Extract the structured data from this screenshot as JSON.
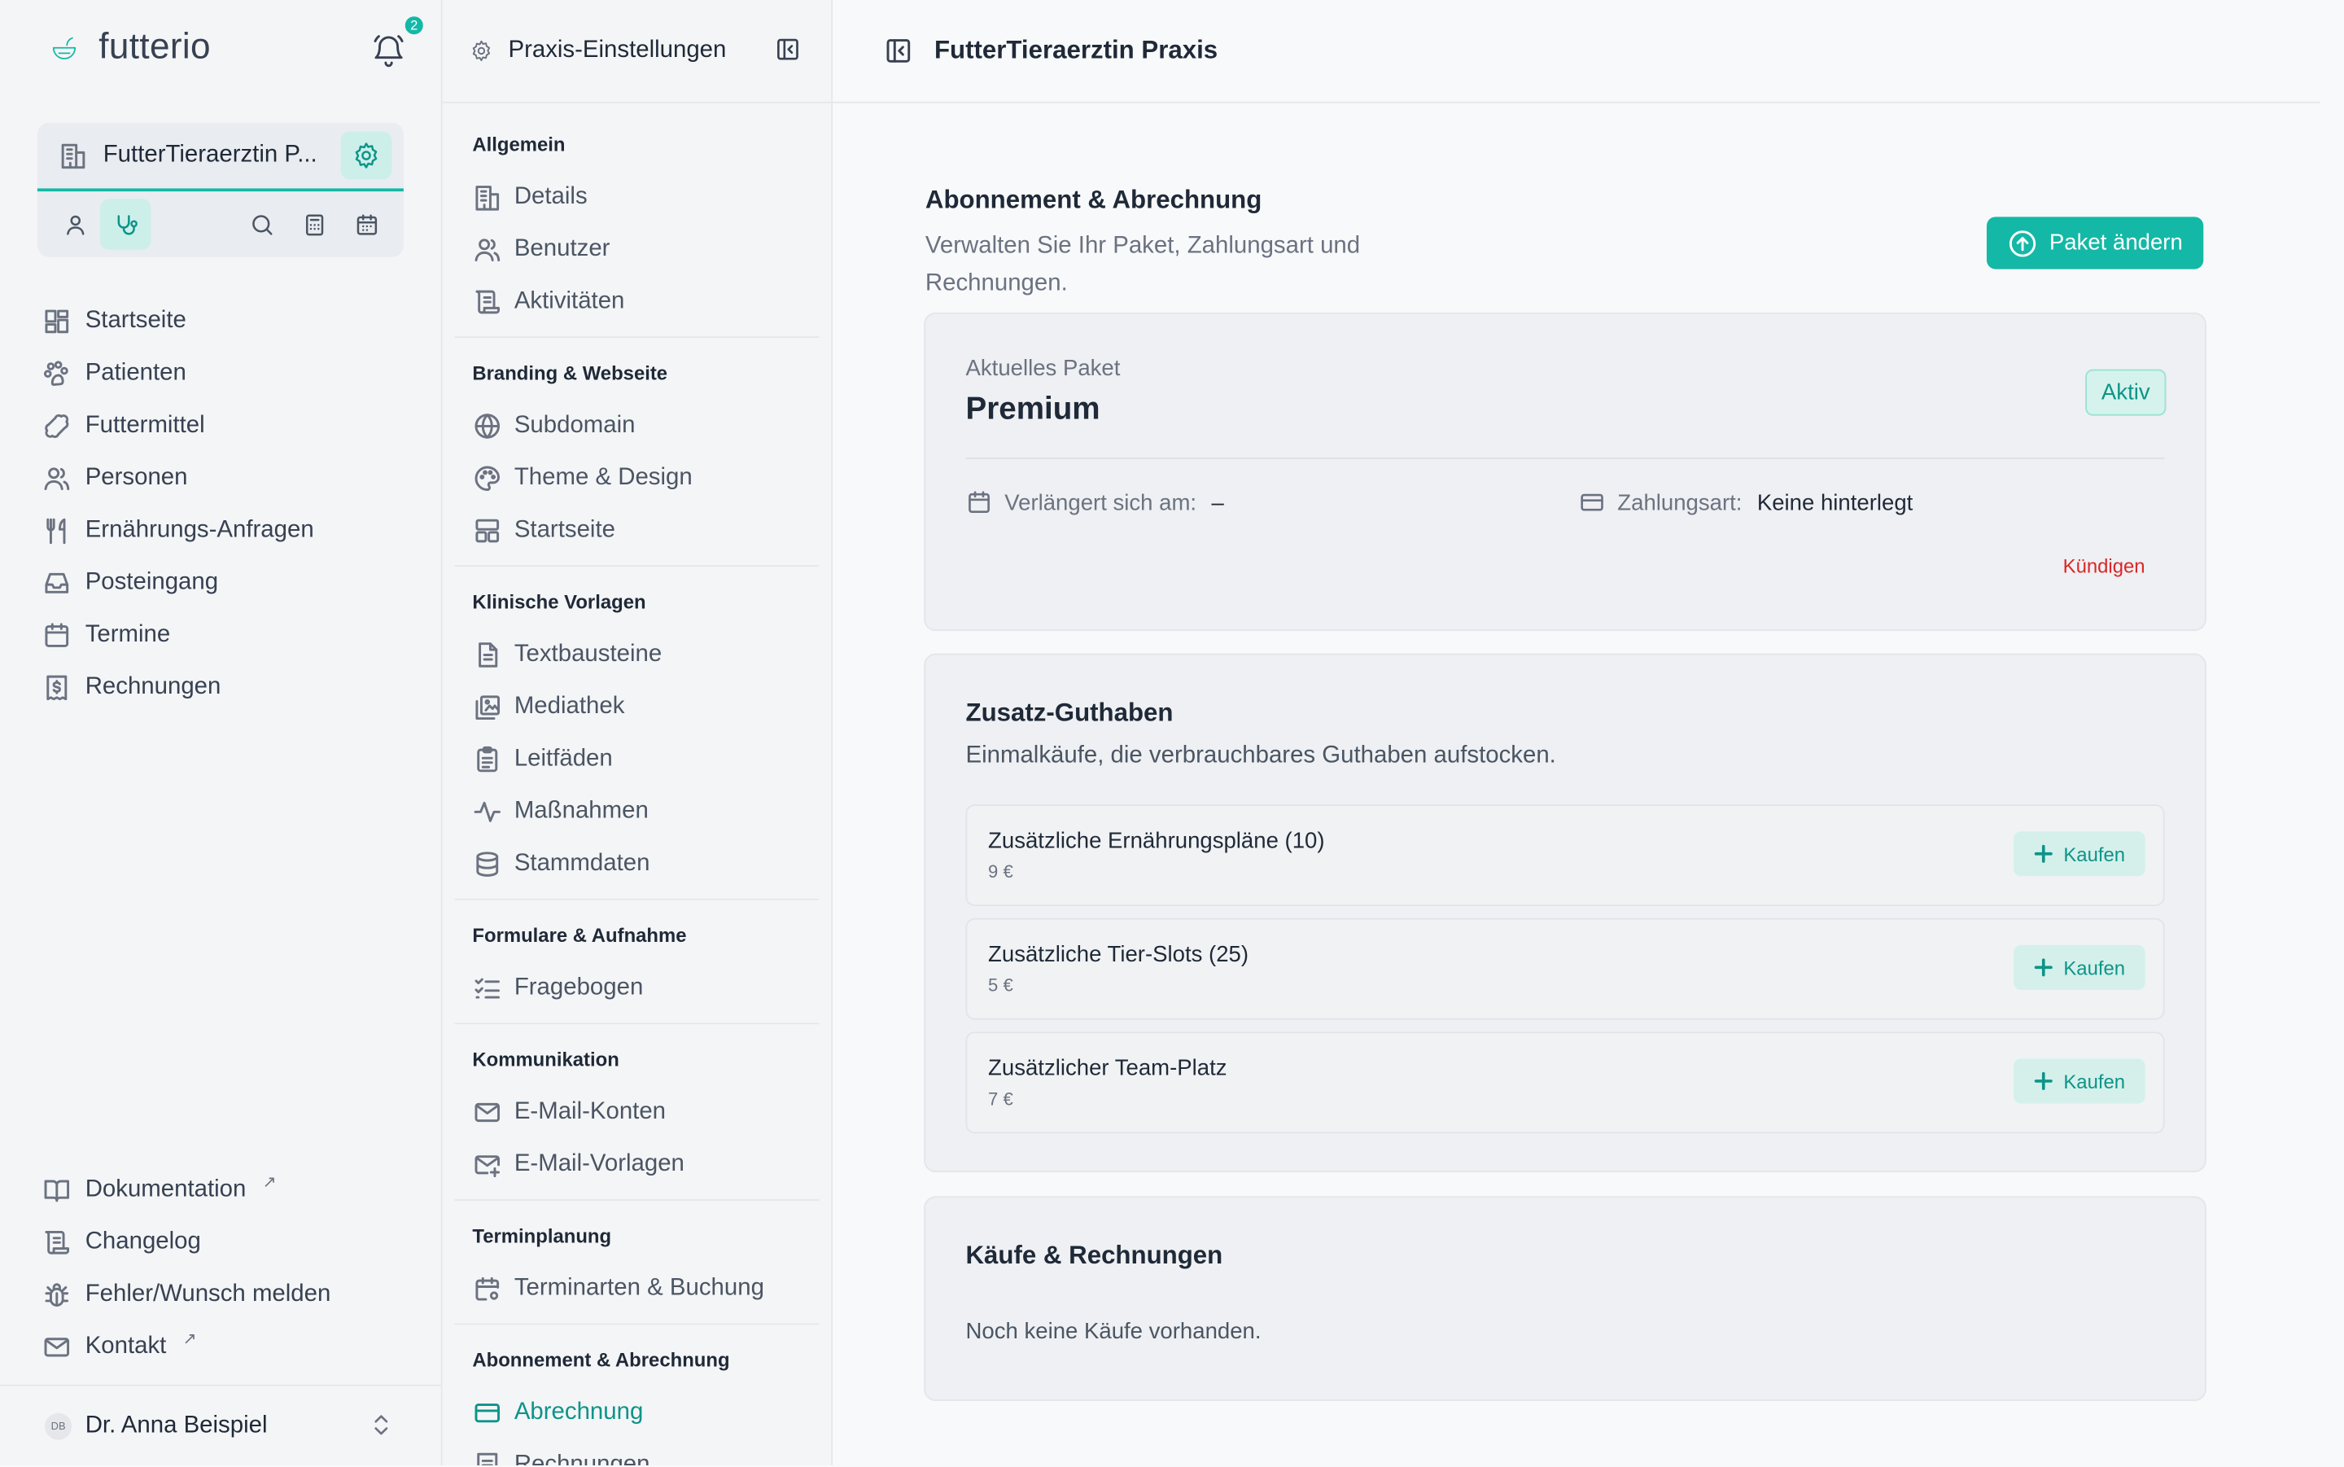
{
  "brand": {
    "name": "futterio",
    "notifications": "2"
  },
  "practice": {
    "name": "FutterTieraerztin P..."
  },
  "nav": {
    "items": [
      {
        "label": "Startseite"
      },
      {
        "label": "Patienten"
      },
      {
        "label": "Futtermittel"
      },
      {
        "label": "Personen"
      },
      {
        "label": "Ernährungs-Anfragen"
      },
      {
        "label": "Posteingang"
      },
      {
        "label": "Termine"
      },
      {
        "label": "Rechnungen"
      }
    ],
    "bottom": [
      {
        "label": "Dokumentation",
        "ext": "↗"
      },
      {
        "label": "Changelog"
      },
      {
        "label": "Fehler/Wunsch melden"
      },
      {
        "label": "Kontakt",
        "ext": "↗"
      }
    ]
  },
  "user": {
    "initials": "DB",
    "name": "Dr. Anna Beispiel"
  },
  "settings": {
    "title": "Praxis-Einstellungen",
    "groups": [
      {
        "title": "Allgemein",
        "items": [
          {
            "label": "Details"
          },
          {
            "label": "Benutzer"
          },
          {
            "label": "Aktivitäten"
          }
        ]
      },
      {
        "title": "Branding & Webseite",
        "items": [
          {
            "label": "Subdomain"
          },
          {
            "label": "Theme & Design"
          },
          {
            "label": "Startseite"
          }
        ]
      },
      {
        "title": "Klinische Vorlagen",
        "items": [
          {
            "label": "Textbausteine"
          },
          {
            "label": "Mediathek"
          },
          {
            "label": "Leitfäden"
          },
          {
            "label": "Maßnahmen"
          },
          {
            "label": "Stammdaten"
          }
        ]
      },
      {
        "title": "Formulare & Aufnahme",
        "items": [
          {
            "label": "Fragebogen"
          }
        ]
      },
      {
        "title": "Kommunikation",
        "items": [
          {
            "label": "E-Mail-Konten"
          },
          {
            "label": "E-Mail-Vorlagen"
          }
        ]
      },
      {
        "title": "Terminplanung",
        "items": [
          {
            "label": "Terminarten & Buchung"
          }
        ]
      },
      {
        "title": "Abonnement & Abrechnung",
        "items": [
          {
            "label": "Abrechnung"
          },
          {
            "label": "Rechnungen"
          }
        ]
      }
    ]
  },
  "main": {
    "title": "FutterTieraerztin Praxis",
    "section_title": "Abonnement & Abrechnung",
    "section_sub": "Verwalten Sie Ihr Paket, Zahlungsart und Rechnungen.",
    "change_plan": "Paket ändern",
    "plan": {
      "label": "Aktuelles Paket",
      "name": "Premium",
      "status": "Aktiv",
      "renew_label": "Verlängert sich am:",
      "renew_value": "–",
      "payment_label": "Zahlungsart:",
      "payment_value": "Keine hinterlegt",
      "cancel": "Kündigen"
    },
    "credits": {
      "title": "Zusatz-Guthaben",
      "subtitle": "Einmalkäufe, die verbrauchbares Guthaben aufstocken.",
      "buy_label": "Kaufen",
      "items": [
        {
          "name": "Zusätzliche Ernährungspläne (10)",
          "price": "9 €"
        },
        {
          "name": "Zusätzliche Tier-Slots (25)",
          "price": "5 €"
        },
        {
          "name": "Zusätzlicher Team-Platz",
          "price": "7 €"
        }
      ]
    },
    "invoices": {
      "title": "Käufe & Rechnungen",
      "empty": "Noch keine Käufe vorhanden."
    }
  },
  "colors": {
    "accent": "#14b8a6",
    "accent_dark": "#0d9488",
    "danger": "#dc2626"
  }
}
